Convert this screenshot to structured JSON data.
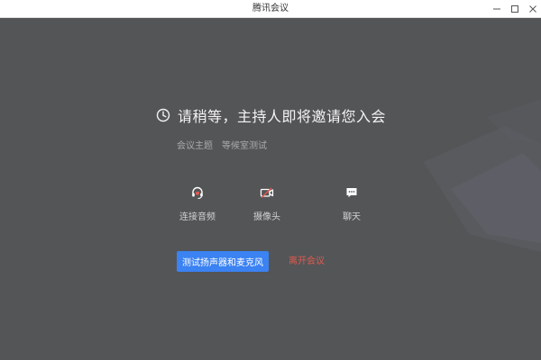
{
  "window": {
    "title": "腾讯会议",
    "controls": {
      "minimize_icon": "minimize-icon",
      "maximize_icon": "maximize-icon",
      "close_icon": "close-icon"
    }
  },
  "waiting_room": {
    "message": "请稍等，主持人即将邀请您入会",
    "topic_label": "会议主题",
    "topic_value": "等候室测试"
  },
  "toolbar": {
    "items": [
      {
        "label": "连接音频",
        "icon": "headset-icon"
      },
      {
        "label": "摄像头",
        "icon": "camera-off-icon"
      },
      {
        "label": "聊天",
        "icon": "chat-icon"
      }
    ]
  },
  "actions": {
    "test_button_label": "测试扬声器和麦克风",
    "leave_label": "离开会议"
  },
  "colors": {
    "background": "#545557",
    "primary": "#3b82f2",
    "danger": "#e05a4f"
  }
}
